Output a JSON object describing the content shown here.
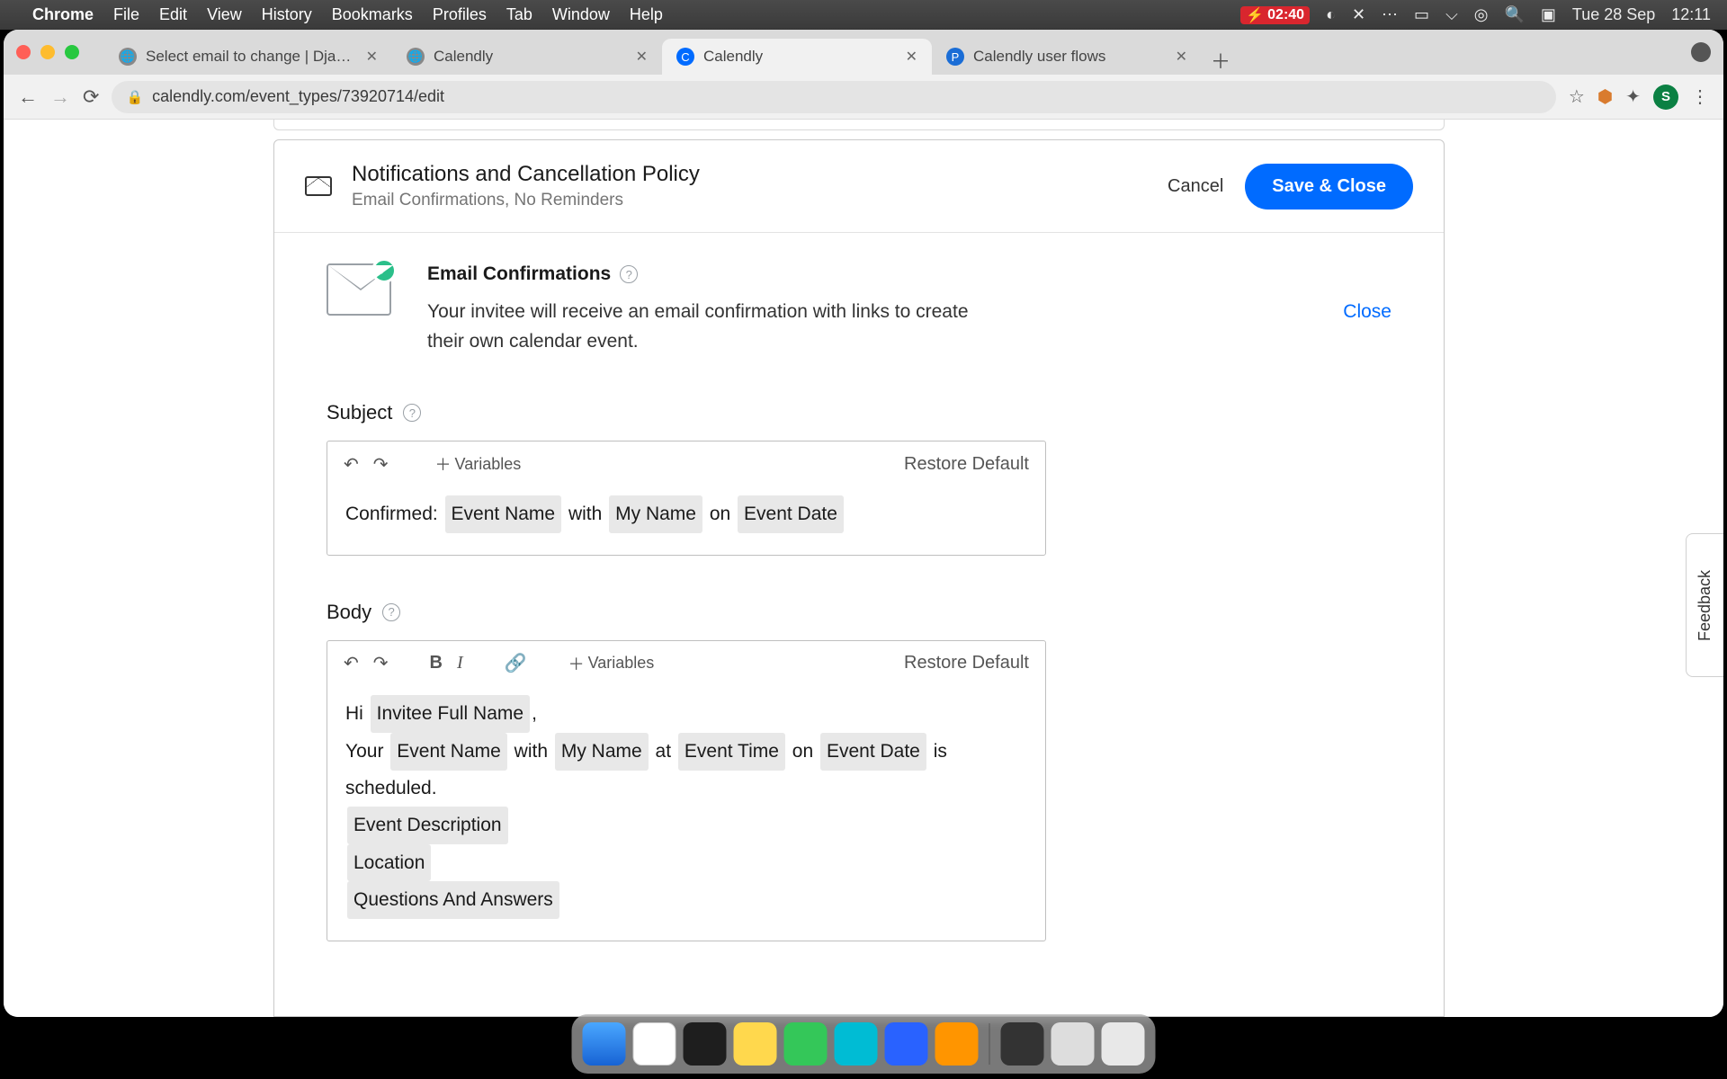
{
  "menubar": {
    "app": "Chrome",
    "items": [
      "File",
      "Edit",
      "View",
      "History",
      "Bookmarks",
      "Profiles",
      "Tab",
      "Window",
      "Help"
    ],
    "battery": "02:40",
    "date": "Tue 28 Sep",
    "time": "12:11"
  },
  "browser": {
    "tabs": [
      {
        "title": "Select email to change | Django",
        "active": false,
        "fav": "generic"
      },
      {
        "title": "Calendly",
        "active": false,
        "fav": "generic"
      },
      {
        "title": "Calendly",
        "active": true,
        "fav": "calendly"
      },
      {
        "title": "Calendly user flows",
        "active": false,
        "fav": "p"
      }
    ],
    "url": "calendly.com/event_types/73920714/edit",
    "avatar": "S"
  },
  "panel": {
    "title": "Notifications and Cancellation Policy",
    "subtitle": "Email Confirmations, No Reminders",
    "cancel": "Cancel",
    "save": "Save & Close"
  },
  "confirm": {
    "heading": "Email Confirmations",
    "desc": "Your invitee will receive an email confirmation with links to create their own calendar event.",
    "close": "Close"
  },
  "subject": {
    "label": "Subject",
    "variables": "Variables",
    "restore": "Restore Default",
    "prefix": "Confirmed: ",
    "chips": {
      "event_name": "Event Name",
      "my_name": "My Name",
      "event_date": "Event Date"
    },
    "joins": {
      "with": " with ",
      "on": " on "
    }
  },
  "body": {
    "label": "Body",
    "variables": "Variables",
    "restore": "Restore Default",
    "l1_pre": "Hi ",
    "l1_chip": "Invitee Full Name",
    "l1_post": ",",
    "l2_pre": "Your ",
    "l2_c1": "Event Name",
    "l2_j1": " with ",
    "l2_c2": "My Name",
    "l2_j2": " at ",
    "l2_c3": "Event Time",
    "l2_j3": " on ",
    "l2_c4": "Event Date",
    "l2_post": " is scheduled.",
    "l3": "Event Description",
    "l4": "Location",
    "l5": "Questions And Answers"
  },
  "feedback": "Feedback"
}
